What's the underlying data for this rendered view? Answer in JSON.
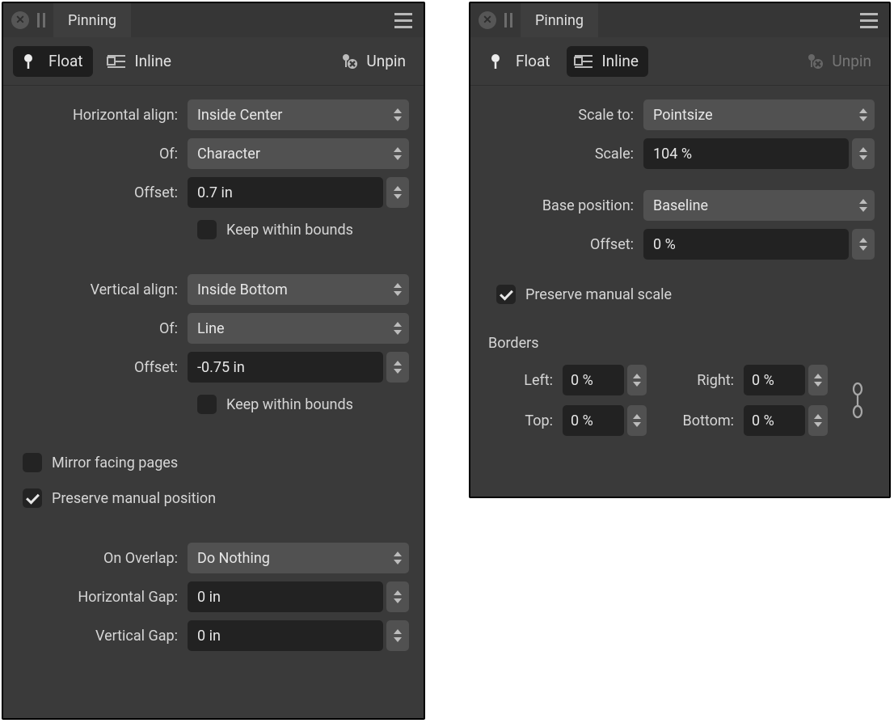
{
  "left": {
    "title": "Pinning",
    "modes": {
      "float": "Float",
      "inline": "Inline",
      "unpin": "Unpin",
      "selected": "float"
    },
    "halign": {
      "label": "Horizontal align:",
      "value": "Inside Center"
    },
    "hof": {
      "label": "Of:",
      "value": "Character"
    },
    "hoffset": {
      "label": "Offset:",
      "value": "0.7 in"
    },
    "hkeep": {
      "label": "Keep within bounds",
      "checked": false
    },
    "valign": {
      "label": "Vertical align:",
      "value": "Inside Bottom"
    },
    "vof": {
      "label": "Of:",
      "value": "Line"
    },
    "voffset": {
      "label": "Offset:",
      "value": "-0.75 in"
    },
    "vkeep": {
      "label": "Keep within bounds",
      "checked": false
    },
    "mirror": {
      "label": "Mirror facing pages",
      "checked": false
    },
    "preservePos": {
      "label": "Preserve manual position",
      "checked": true
    },
    "overlap": {
      "label": "On Overlap:",
      "value": "Do Nothing"
    },
    "hgap": {
      "label": "Horizontal Gap:",
      "value": "0 in"
    },
    "vgap": {
      "label": "Vertical Gap:",
      "value": "0 in"
    }
  },
  "right": {
    "title": "Pinning",
    "modes": {
      "float": "Float",
      "inline": "Inline",
      "unpin": "Unpin",
      "selected": "inline",
      "unpinDisabled": true
    },
    "scaleTo": {
      "label": "Scale to:",
      "value": "Pointsize"
    },
    "scale": {
      "label": "Scale:",
      "value": "104 %"
    },
    "basePos": {
      "label": "Base position:",
      "value": "Baseline"
    },
    "offset": {
      "label": "Offset:",
      "value": "0 %"
    },
    "preserveScale": {
      "label": "Preserve manual scale",
      "checked": true
    },
    "bordersTitle": "Borders",
    "borders": {
      "left": {
        "label": "Left:",
        "value": "0 %"
      },
      "right": {
        "label": "Right:",
        "value": "0 %"
      },
      "top": {
        "label": "Top:",
        "value": "0 %"
      },
      "bottom": {
        "label": "Bottom:",
        "value": "0 %"
      }
    }
  }
}
